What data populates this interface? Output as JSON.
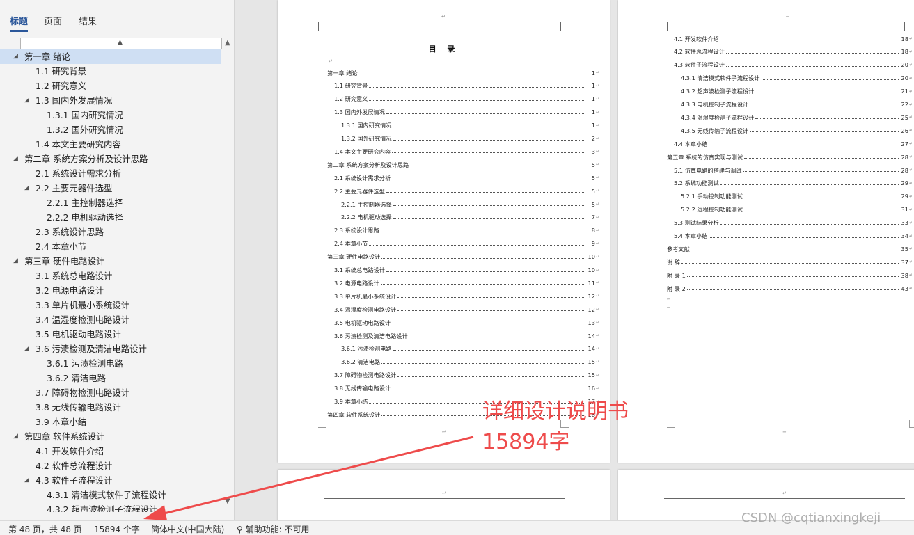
{
  "nav": {
    "tabs": [
      "标题",
      "页面",
      "结果"
    ],
    "tree": [
      {
        "label": "第一章  绪论",
        "level": 0,
        "expanded": true,
        "selected": true
      },
      {
        "label": "1.1 研究背景",
        "level": 1
      },
      {
        "label": "1.2 研究意义",
        "level": 1
      },
      {
        "label": "1.3 国内外发展情况",
        "level": 1,
        "expanded": true
      },
      {
        "label": "1.3.1 国内研究情况",
        "level": 2
      },
      {
        "label": "1.3.2 国外研究情况",
        "level": 2
      },
      {
        "label": "1.4 本文主要研究内容",
        "level": 1
      },
      {
        "label": "第二章  系统方案分析及设计思路",
        "level": 0,
        "expanded": true
      },
      {
        "label": "2.1 系统设计需求分析",
        "level": 1
      },
      {
        "label": "2.2 主要元器件选型",
        "level": 1,
        "expanded": true
      },
      {
        "label": "2.2.1 主控制器选择",
        "level": 2
      },
      {
        "label": "2.2.2 电机驱动选择",
        "level": 2
      },
      {
        "label": "2.3 系统设计思路",
        "level": 1
      },
      {
        "label": "2.4 本章小节",
        "level": 1
      },
      {
        "label": "第三章  硬件电路设计",
        "level": 0,
        "expanded": true
      },
      {
        "label": "3.1 系统总电路设计",
        "level": 1
      },
      {
        "label": "3.2 电源电路设计",
        "level": 1
      },
      {
        "label": "3.3 单片机最小系统设计",
        "level": 1
      },
      {
        "label": "3.4 温湿度检测电路设计",
        "level": 1
      },
      {
        "label": "3.5 电机驱动电路设计",
        "level": 1
      },
      {
        "label": "3.6 污渍检测及清洁电路设计",
        "level": 1,
        "expanded": true
      },
      {
        "label": "3.6.1 污渍检测电路",
        "level": 2
      },
      {
        "label": "3.6.2 清洁电路",
        "level": 2
      },
      {
        "label": "3.7 障碍物检测电路设计",
        "level": 1
      },
      {
        "label": "3.8 无线传输电路设计",
        "level": 1
      },
      {
        "label": "3.9 本章小结",
        "level": 1
      },
      {
        "label": "第四章  软件系统设计",
        "level": 0,
        "expanded": true
      },
      {
        "label": "4.1 开发软件介绍",
        "level": 1
      },
      {
        "label": "4.2 软件总流程设计",
        "level": 1
      },
      {
        "label": "4.3 软件子流程设计",
        "level": 1,
        "expanded": true
      },
      {
        "label": "4.3.1 清洁模式软件子流程设计",
        "level": 2
      },
      {
        "label": "4.3.2 超声波检测子流程设计",
        "level": 2
      }
    ]
  },
  "page1": {
    "title": "目  录",
    "entries": [
      {
        "t": "第一章  绪论",
        "p": "1",
        "lv": 0
      },
      {
        "t": "1.1  研究背景",
        "p": "1",
        "lv": 1
      },
      {
        "t": "1.2  研究意义",
        "p": "1",
        "lv": 1
      },
      {
        "t": "1.3  国内外发展情况",
        "p": "1",
        "lv": 1
      },
      {
        "t": "1.3.1  国内研究情况",
        "p": "1",
        "lv": 2
      },
      {
        "t": "1.3.2  国外研究情况",
        "p": "2",
        "lv": 2
      },
      {
        "t": "1.4  本文主要研究内容",
        "p": "3",
        "lv": 1
      },
      {
        "t": "第二章  系统方案分析及设计思路",
        "p": "5",
        "lv": 0
      },
      {
        "t": "2.1  系统设计需求分析",
        "p": "5",
        "lv": 1
      },
      {
        "t": "2.2  主要元器件选型",
        "p": "5",
        "lv": 1
      },
      {
        "t": "2.2.1  主控制器选择",
        "p": "5",
        "lv": 2
      },
      {
        "t": "2.2.2  电机驱动选择",
        "p": "7",
        "lv": 2
      },
      {
        "t": "2.3  系统设计思路",
        "p": "8",
        "lv": 1
      },
      {
        "t": "2.4  本章小节",
        "p": "9",
        "lv": 1
      },
      {
        "t": "第三章  硬件电路设计",
        "p": "10",
        "lv": 0
      },
      {
        "t": "3.1  系统总电路设计",
        "p": "10",
        "lv": 1
      },
      {
        "t": "3.2  电源电路设计",
        "p": "11",
        "lv": 1
      },
      {
        "t": "3.3  单片机最小系统设计",
        "p": "12",
        "lv": 1
      },
      {
        "t": "3.4  温湿度检测电路设计",
        "p": "12",
        "lv": 1
      },
      {
        "t": "3.5  电机驱动电路设计",
        "p": "13",
        "lv": 1
      },
      {
        "t": "3.6  污渍检测及清洁电路设计",
        "p": "14",
        "lv": 1
      },
      {
        "t": "3.6.1  污渍检测电路",
        "p": "14",
        "lv": 2
      },
      {
        "t": "3.6.2  清洁电路",
        "p": "15",
        "lv": 2
      },
      {
        "t": "3.7  障碍物检测电路设计",
        "p": "15",
        "lv": 1
      },
      {
        "t": "3.8  无线传输电路设计",
        "p": "16",
        "lv": 1
      },
      {
        "t": "3.9  本章小结",
        "p": "17",
        "lv": 1
      },
      {
        "t": "第四章  软件系统设计",
        "p": "18",
        "lv": 0
      }
    ]
  },
  "page2": {
    "entries": [
      {
        "t": "4.1  开发软件介绍",
        "p": "18",
        "lv": 1
      },
      {
        "t": "4.2  软件总流程设计",
        "p": "18",
        "lv": 1
      },
      {
        "t": "4.3  软件子流程设计",
        "p": "20",
        "lv": 1
      },
      {
        "t": "4.3.1  清洁模式软件子流程设计",
        "p": "20",
        "lv": 2
      },
      {
        "t": "4.3.2  超声波检测子流程设计",
        "p": "21",
        "lv": 2
      },
      {
        "t": "4.3.3  电机控制子流程设计",
        "p": "22",
        "lv": 2
      },
      {
        "t": "4.3.4  温湿度检测子流程设计",
        "p": "25",
        "lv": 2
      },
      {
        "t": "4.3.5  无线传输子流程设计",
        "p": "26",
        "lv": 2
      },
      {
        "t": "4.4  本章小结",
        "p": "27",
        "lv": 1
      },
      {
        "t": "第五章  系统的仿真实现与测试",
        "p": "28",
        "lv": 0
      },
      {
        "t": "5.1  仿真电路的搭建与调试",
        "p": "28",
        "lv": 1
      },
      {
        "t": "5.2  系统功能测试",
        "p": "29",
        "lv": 1
      },
      {
        "t": "5.2.1  手动控制功能测试",
        "p": "29",
        "lv": 2
      },
      {
        "t": "5.2.2  远程控制功能测试",
        "p": "31",
        "lv": 2
      },
      {
        "t": "5.3  测试结果分析",
        "p": "33",
        "lv": 1
      },
      {
        "t": "5.4  本章小结",
        "p": "34",
        "lv": 1
      },
      {
        "t": "参考文献",
        "p": "35",
        "lv": 0
      },
      {
        "t": "谢  辞",
        "p": "37",
        "lv": 0
      },
      {
        "t": "附  录 1",
        "p": "38",
        "lv": 0
      },
      {
        "t": "附  录 2",
        "p": "43",
        "lv": 0
      }
    ]
  },
  "annotation": {
    "line1": "详细设计说明书",
    "line2": "15894字",
    "color": "#ee4b4b"
  },
  "status": {
    "page": "第 48 页，共 48 页",
    "words": "15894 个字",
    "language": "简体中文(中国大陆)",
    "accessibility": "辅助功能: 不可用"
  },
  "watermark": "CSDN @cqtianxingkeji"
}
